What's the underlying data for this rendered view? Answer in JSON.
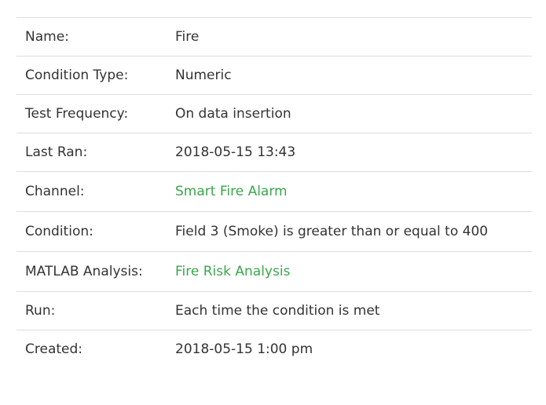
{
  "details": {
    "rows": [
      {
        "label": "Name:",
        "value": "Fire",
        "is_link": false
      },
      {
        "label": "Condition Type:",
        "value": "Numeric",
        "is_link": false
      },
      {
        "label": "Test Frequency:",
        "value": "On data insertion",
        "is_link": false
      },
      {
        "label": "Last Ran:",
        "value": "2018-05-15 13:43",
        "is_link": false
      },
      {
        "label": "Channel:",
        "value": "Smart Fire Alarm",
        "is_link": true
      },
      {
        "label": "Condition:",
        "value": "Field 3 (Smoke) is greater than or equal to 400",
        "is_link": false
      },
      {
        "label": "MATLAB Analysis:",
        "value": "Fire Risk Analysis",
        "is_link": true
      },
      {
        "label": "Run:",
        "value": "Each time the condition is met",
        "is_link": false
      },
      {
        "label": "Created:",
        "value": "2018-05-15 1:00 pm",
        "is_link": false
      }
    ]
  },
  "colors": {
    "text": "#333333",
    "link": "#3aa64c",
    "divider": "#dddddd"
  }
}
